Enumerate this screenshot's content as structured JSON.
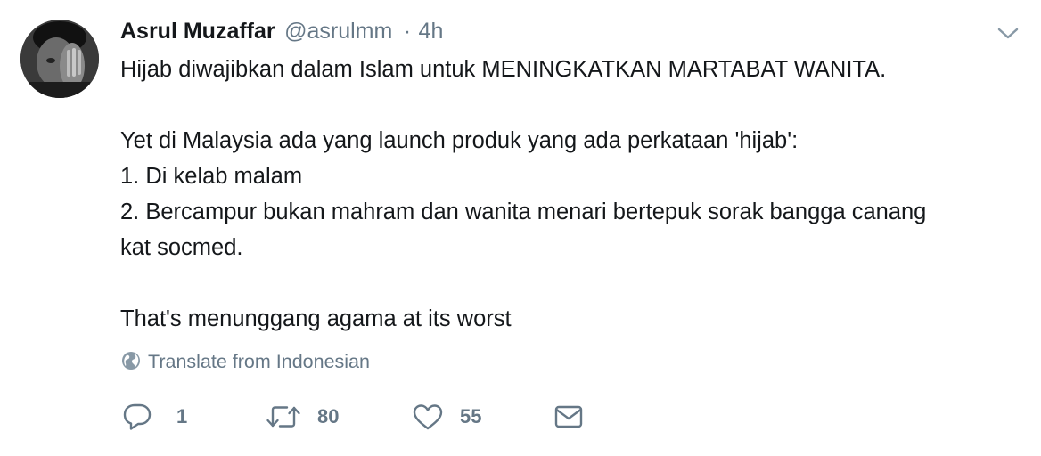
{
  "user": {
    "name": "Asrul Muzaffar",
    "handle": "@asrulmm",
    "separator": "·",
    "time": "4h"
  },
  "tweet": {
    "lines": [
      "Hijab diwajibkan dalam Islam untuk MENINGKATKAN MARTABAT WANITA.",
      "",
      "Yet di Malaysia ada yang launch produk yang ada perkataan 'hijab':",
      "1. Di kelab malam",
      "2. Bercampur bukan mahram dan wanita menari bertepuk sorak bangga canang",
      "kat socmed.",
      "",
      "That's menunggang agama at its worst"
    ]
  },
  "translate": {
    "label": "Translate from Indonesian",
    "icon": "globe-icon"
  },
  "actions": {
    "reply": {
      "icon": "reply-icon",
      "count": "1"
    },
    "retweet": {
      "icon": "retweet-icon",
      "count": "80"
    },
    "like": {
      "icon": "heart-icon",
      "count": "55"
    },
    "message": {
      "icon": "envelope-icon"
    }
  },
  "colors": {
    "text": "#14171a",
    "secondary": "#657786",
    "background": "#ffffff"
  }
}
